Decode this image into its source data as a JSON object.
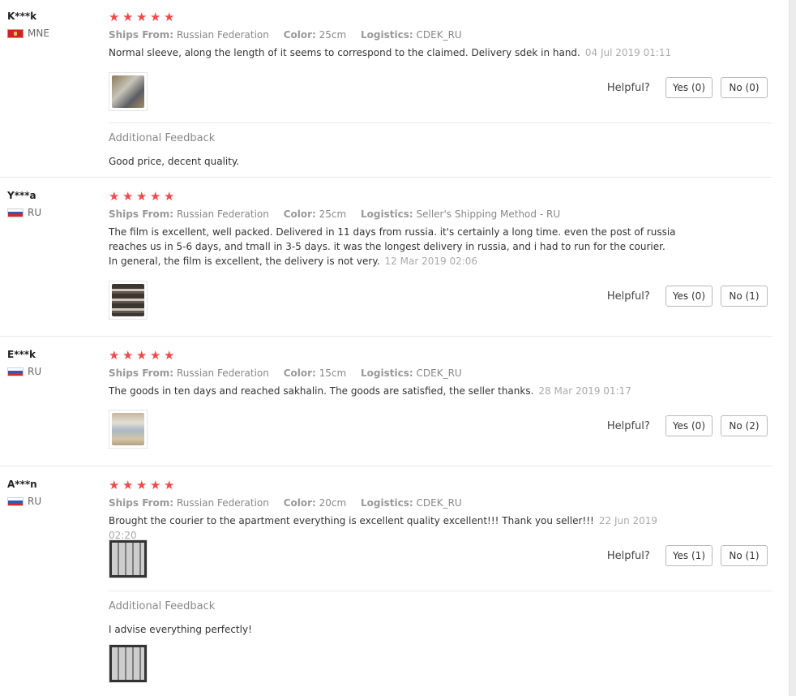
{
  "reviews": [
    {
      "user": "K***k",
      "country": "MNE",
      "stars": 5,
      "ships_from_label": "Ships From:",
      "ships_from": "Russian Federation",
      "color_label": "Color:",
      "color": "25cm",
      "logistics_label": "Logistics:",
      "logistics": "CDEK_RU",
      "text": "Normal sleeve, along the length of it seems to correspond to the claimed. Delivery sdek in hand.",
      "date": "04 Jul 2019 01:11",
      "helpful_label": "Helpful?",
      "yes": "Yes (0)",
      "no": "No (0)",
      "additional_title": "Additional Feedback",
      "additional_text": "Good price, decent quality."
    },
    {
      "user": "Y***a",
      "country": "RU",
      "stars": 5,
      "ships_from_label": "Ships From:",
      "ships_from": "Russian Federation",
      "color_label": "Color:",
      "color": "25cm",
      "logistics_label": "Logistics:",
      "logistics": "Seller's Shipping Method - RU",
      "text": "The film is excellent, well packed. Delivered in 11 days from russia. it's certainly a long time. even the post of russia reaches us in 5-6 days, and tmall in 3-5 days. it was the longest delivery in russia, and i had to run for the courier. In general, the film is excellent, the delivery is not very.",
      "date": "12 Mar 2019 02:06",
      "helpful_label": "Helpful?",
      "yes": "Yes (0)",
      "no": "No (1)"
    },
    {
      "user": "E***k",
      "country": "RU",
      "stars": 5,
      "ships_from_label": "Ships From:",
      "ships_from": "Russian Federation",
      "color_label": "Color:",
      "color": "15cm",
      "logistics_label": "Logistics:",
      "logistics": "CDEK_RU",
      "text": "The goods in ten days and reached sakhalin. The goods are satisfied, the seller thanks.",
      "date": "28 Mar 2019 01:17",
      "helpful_label": "Helpful?",
      "yes": "Yes (0)",
      "no": "No (2)"
    },
    {
      "user": "A***n",
      "country": "RU",
      "stars": 5,
      "ships_from_label": "Ships From:",
      "ships_from": "Russian Federation",
      "color_label": "Color:",
      "color": "20cm",
      "logistics_label": "Logistics:",
      "logistics": "CDEK_RU",
      "text": "Brought the courier to the apartment everything is excellent quality excellent!!! Thank you seller!!!",
      "date": "22 Jun 2019 02:20",
      "helpful_label": "Helpful?",
      "yes": "Yes (1)",
      "no": "No (1)",
      "additional_title": "Additional Feedback",
      "additional_text": "I advise everything perfectly!"
    }
  ],
  "colors": {
    "star": "#f04a4a",
    "meta_key": "#999999",
    "date": "#aaaaaa"
  }
}
